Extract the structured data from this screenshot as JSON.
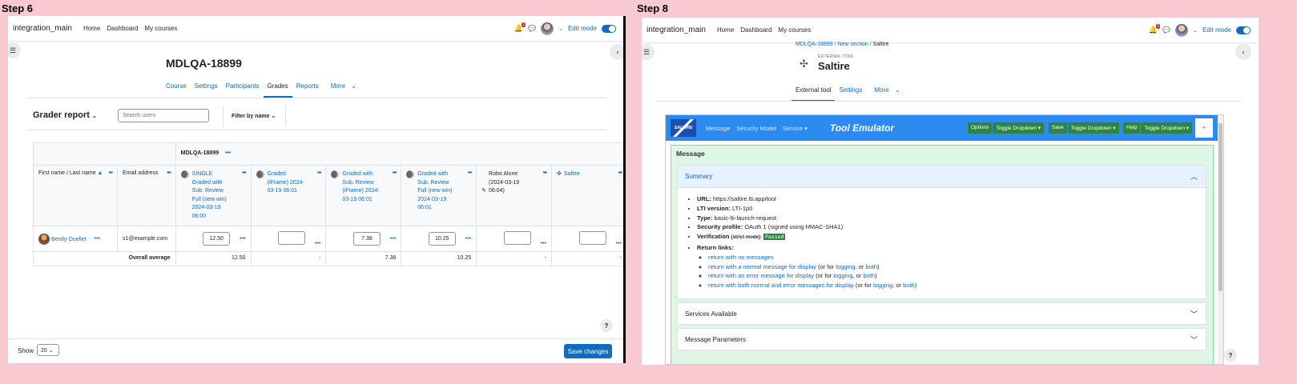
{
  "left": {
    "step_label": "Step 6",
    "nav": {
      "brand": "integration_main",
      "links": [
        "Home",
        "Dashboard",
        "My courses"
      ],
      "bell_count": "1",
      "edit_mode": "Edit mode"
    },
    "page_title": "MDLQA-18899",
    "tabs": [
      "Course",
      "Settings",
      "Participants",
      "Grades",
      "Reports",
      "More"
    ],
    "grader_report": "Grader report",
    "search_placeholder": "Search users",
    "filter_by_name": "Filter by name",
    "course_header": "MDLQA-18899",
    "col_name": "First name / Last name",
    "col_email": "Email address",
    "items": [
      {
        "label": "SINGLE Graded with Sub. Review Full (new win) 2024-03-19 06:00",
        "value": "12.50",
        "avg": "12.50"
      },
      {
        "label": "Graded (iFrame) 2024-03-19 06:01",
        "value": "",
        "avg": "-"
      },
      {
        "label": "Graded with Sub. Review (iFrame) 2024-03-19 06:01",
        "value": "7.38",
        "avg": "7.38"
      },
      {
        "label": "Graded with Sub. Review Full (new win) 2024-03-19 06:01",
        "value": "10.25",
        "avg": "10.25"
      },
      {
        "label": "Robo Alone (2024-03-19 06:04)",
        "value": "",
        "avg": "-"
      },
      {
        "label": "Saltire",
        "value": "",
        "avg": "-"
      }
    ],
    "student": {
      "name": "Bently Ouellet",
      "email": "s1@example.com"
    },
    "overall_average": "Overall average",
    "show_label": "Show",
    "show_value": "20",
    "save_changes": "Save changes",
    "help": "?"
  },
  "right": {
    "step_label": "Step 8",
    "nav": {
      "brand": "integration_main",
      "links": [
        "Home",
        "Dashboard",
        "My courses"
      ],
      "bell_count": "1",
      "edit_mode": "Edit mode"
    },
    "breadcrumb": [
      "MDLQA-18899",
      "New section",
      "Saltire"
    ],
    "kicker": "EXTERNAL TOOL",
    "title": "Saltire",
    "tabs": [
      "External tool",
      "Settings",
      "More"
    ],
    "emulator": {
      "logo": "SALTIRE",
      "menu": [
        "Message",
        "Security Model",
        "Service"
      ],
      "heading": "Tool Emulator",
      "options": "Options",
      "save": "Save",
      "help": "Help",
      "toggle": "Toggle Dropdown"
    },
    "message_title": "Message",
    "summary_title": "Summary",
    "summary": {
      "url_label": "URL:",
      "url": "https://saltire.lti.app/tool",
      "lti_label": "LTI version:",
      "lti": "LTI-1p0",
      "type_label": "Type:",
      "type": "basic-lti-launch-request",
      "sec_label": "Security profile:",
      "sec": "OAuth 1 (signed using HMAC-SHA1)",
      "ver_label": "Verification",
      "ver_mode": "(strict mode):",
      "ver_status": "Passed",
      "ret_label": "Return links:",
      "links": [
        {
          "text": "return with no messages",
          "tail": ""
        },
        {
          "text": "return with a normal message for display",
          "tail": "normal"
        },
        {
          "text": "return with an error message for display",
          "tail": "error"
        },
        {
          "text": "return with both normal and error messages for display",
          "tail": "both"
        }
      ],
      "or_for": "(or for",
      "logging": "logging",
      "or": ", or",
      "both": "both",
      "close": ")"
    },
    "services_available": "Services Available",
    "message_parameters": "Message Parameters",
    "help": "?"
  }
}
